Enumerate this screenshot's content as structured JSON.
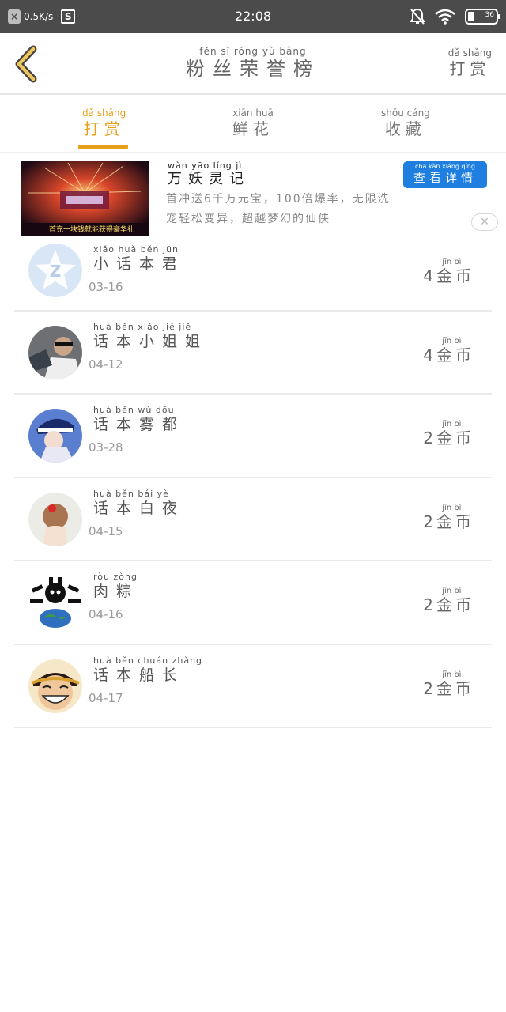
{
  "status_bar": {
    "net_speed": "0.5K/s",
    "time": "22:08",
    "battery": "36"
  },
  "header": {
    "title_pinyin": "fěn  sī  róng  yù  bǎng",
    "title": "粉丝荣誉榜",
    "right_pinyin": "dǎ  shǎng",
    "right_label": "打赏"
  },
  "tabs": [
    {
      "pinyin": "dǎ  shǎng",
      "label": "打赏",
      "active": true
    },
    {
      "pinyin": "xiān  huā",
      "label": "鲜花",
      "active": false
    },
    {
      "pinyin": "shōu  cáng",
      "label": "收藏",
      "active": false
    }
  ],
  "ad": {
    "image_caption": "首充一块钱就能获得豪华礼",
    "title_pinyin": "wàn  yāo  líng  jì",
    "title": "万妖灵记",
    "cta_pinyin": "chá  kàn  xiáng  qíng",
    "cta": "查看详情",
    "desc_line1": "首冲送6千万元宝，100倍爆率，无限洗",
    "desc_line2": "宠轻松变异，超越梦幻的仙侠"
  },
  "colors": {
    "accent": "#e8a01a",
    "cta_blue": "#1e7fe0",
    "status_bar": "#4b4b4b"
  },
  "rows": [
    {
      "name_pinyin": "xiǎo   huà   běn   jūn",
      "name": "小话本君",
      "date": "03-16",
      "amount_pinyin": "jīn  bì",
      "amount": "4金币",
      "avatar": "z-logo-icon"
    },
    {
      "name_pinyin": "huà   běn   xiǎo   jiě   jiě",
      "name": "话本小姐姐",
      "date": "04-12",
      "amount_pinyin": "jīn  bì",
      "amount": "4金币",
      "avatar": "person-avatar"
    },
    {
      "name_pinyin": "huà   běn   wù   dōu",
      "name": "话本雾都",
      "date": "03-28",
      "amount_pinyin": "jīn  bì",
      "amount": "2金币",
      "avatar": "anime-avatar"
    },
    {
      "name_pinyin": "huà   běn   bái   yè",
      "name": "话本白夜",
      "date": "04-15",
      "amount_pinyin": "jīn  bì",
      "amount": "2金币",
      "avatar": "girl-avatar"
    },
    {
      "name_pinyin": "ròu   zòng",
      "name": "肉粽",
      "date": "04-16",
      "amount_pinyin": "jīn  bì",
      "amount": "2金币",
      "avatar": "octopus-globe-avatar"
    },
    {
      "name_pinyin": "huà   běn   chuán zhǎng",
      "name": "话本船长",
      "date": "04-17",
      "amount_pinyin": "jīn  bì",
      "amount": "2金币",
      "avatar": "luffy-avatar"
    }
  ]
}
